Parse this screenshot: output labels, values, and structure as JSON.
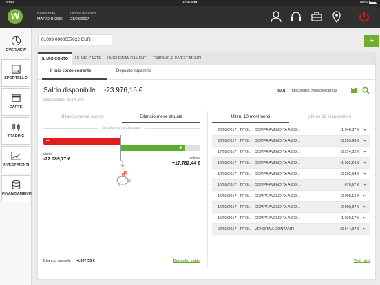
{
  "status_bar": {
    "carrier": "Carrier",
    "time": "4:06 PM",
    "battery": "100%"
  },
  "header": {
    "logo_letter": "W",
    "welcome_label": "Benvenuto,",
    "user_name": "MARIO ROSSI",
    "last_access_label": "Ultimo accesso:",
    "last_access_date": "21/03/2017",
    "icons": [
      "user-icon",
      "headset-icon",
      "briefcase-icon",
      "location-icon",
      "power-icon"
    ],
    "accent_color": "#e0161b"
  },
  "sidebar": {
    "items": [
      {
        "label": "OVERVIEW",
        "icon": "pie-chart-icon"
      },
      {
        "label": "SPORTELLO",
        "icon": "atm-icon"
      },
      {
        "label": "CARTE",
        "icon": "card-icon"
      },
      {
        "label": "TRADING",
        "icon": "candlestick-icon"
      },
      {
        "label": "INVESTIMENTI",
        "icon": "line-chart-icon"
      },
      {
        "label": "FINANZIAMENTI",
        "icon": "coins-icon"
      }
    ]
  },
  "account_selector": {
    "value": "01099 0000057022 EUR"
  },
  "add_button": {
    "label": "+",
    "color": "#6fae2f"
  },
  "tabs": [
    {
      "label": "IL MIO CONTO",
      "active": true
    },
    {
      "label": "LE MIE CARTE"
    },
    {
      "label": "I MIEI FINANZIAMENTI"
    },
    {
      "label": "TRADING E INVESTIMENTI"
    }
  ],
  "subtabs": [
    {
      "label": "Il mio conto corrente",
      "active": true
    },
    {
      "label": "Deposito risparmio"
    }
  ],
  "balance": {
    "label": "Saldo disponibile",
    "value": "-23.976,15 €",
    "accounting": "Saldo contabile: -23.976,15 €",
    "iban_label": "IBAN",
    "iban_value": "IT44C0558401799000000057022"
  },
  "left_panel": {
    "tabs": [
      {
        "label": "Bilancio mese scorso"
      },
      {
        "label": "Bilancio mese attuale",
        "active": true
      }
    ],
    "date_range": "da 01/03/2017  a 21/03/2017",
    "minus_sign": "–",
    "plus_sign": "+",
    "uscite_label": "uscite",
    "uscite_value": "-22.089,77 €",
    "entrate_label": "entrate",
    "entrate_value": "+17.782,44 €",
    "monthly_label": "Bilancio mensile",
    "monthly_value": "-4.307,33 €",
    "detail_link": "Dettaglio saldo",
    "red": "#e31c1c",
    "green": "#5cae2e"
  },
  "right_panel": {
    "tabs": [
      {
        "label": "Ultimi 10 movimenti",
        "active": true
      },
      {
        "label": "Ultime 10 disposizioni"
      }
    ],
    "movements": [
      {
        "date": "20/03/2017",
        "desc": "TITOLI - COMPRAVENDITA A CO...",
        "amount": "-1.946,37 €"
      },
      {
        "date": "20/03/2017",
        "desc": "TITOLI - COMPRAVENDITA A CO...",
        "amount": "-3.253,98 €"
      },
      {
        "date": "17/03/2017",
        "desc": "TITOLI - COMPRAVENDITA A CO...",
        "amount": "-3.274,82 €"
      },
      {
        "date": "16/03/2017",
        "desc": "TITOLI - COMPRAVENDITA A CO...",
        "amount": "-1.632,26 €"
      },
      {
        "date": "16/03/2017",
        "desc": "TITOLI - COMPRAVENDITA A CO...",
        "amount": "-3.262,94 €"
      },
      {
        "date": "16/03/2017",
        "desc": "TITOLI - COMPRAVENDITA A CO...",
        "amount": "-970,97 €"
      },
      {
        "date": "16/03/2017",
        "desc": "TITOLI - COMPRAVENDITA A CO...",
        "amount": "-2.908,12 €"
      },
      {
        "date": "16/03/2017",
        "desc": "TITOLI - COMPRAVENDITA A CO...",
        "amount": "-2.900,87 €"
      },
      {
        "date": "15/03/2017",
        "desc": "TITOLI - COMPRAVENDITA A CO...",
        "amount": "-1.939,17 €"
      },
      {
        "date": "02/03/2017",
        "desc": "TITOLI - VENDITA A CONTANTI",
        "amount": "+3.644,37 €"
      }
    ],
    "all_link": "Vedi tutti"
  }
}
